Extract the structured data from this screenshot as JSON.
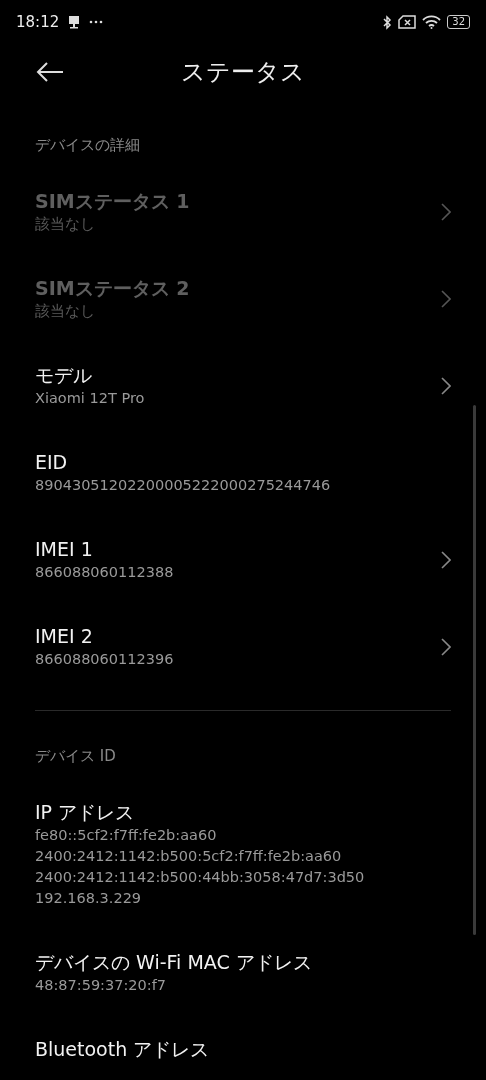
{
  "status_bar": {
    "time": "18:12",
    "battery": "32"
  },
  "header": {
    "title": "ステータス"
  },
  "sections": [
    {
      "title": "デバイスの詳細",
      "items": [
        {
          "title": "SIMステータス 1",
          "values": [
            "該当なし"
          ],
          "disabled": true,
          "chevron": true
        },
        {
          "title": "SIMステータス 2",
          "values": [
            "該当なし"
          ],
          "disabled": true,
          "chevron": true
        },
        {
          "title": "モデル",
          "values": [
            "Xiaomi 12T Pro"
          ],
          "disabled": false,
          "chevron": true
        },
        {
          "title": "EID",
          "values": [
            "89043051202200005222000275244746"
          ],
          "disabled": false,
          "chevron": false
        },
        {
          "title": "IMEI 1",
          "values": [
            "866088060112388"
          ],
          "disabled": false,
          "chevron": true
        },
        {
          "title": "IMEI 2",
          "values": [
            "866088060112396"
          ],
          "disabled": false,
          "chevron": true
        }
      ]
    },
    {
      "title": "デバイス ID",
      "items": [
        {
          "title": "IP アドレス",
          "values": [
            "fe80::5cf2:f7ff:fe2b:aa60",
            "2400:2412:1142:b500:5cf2:f7ff:fe2b:aa60",
            "2400:2412:1142:b500:44bb:3058:47d7:3d50",
            "192.168.3.229"
          ],
          "disabled": false,
          "chevron": false
        },
        {
          "title": "デバイスの Wi-Fi MAC アドレス",
          "values": [
            "48:87:59:37:20:f7"
          ],
          "disabled": false,
          "chevron": false
        },
        {
          "title": "Bluetooth アドレス",
          "disabled": false,
          "chevron": false
        }
      ]
    }
  ]
}
